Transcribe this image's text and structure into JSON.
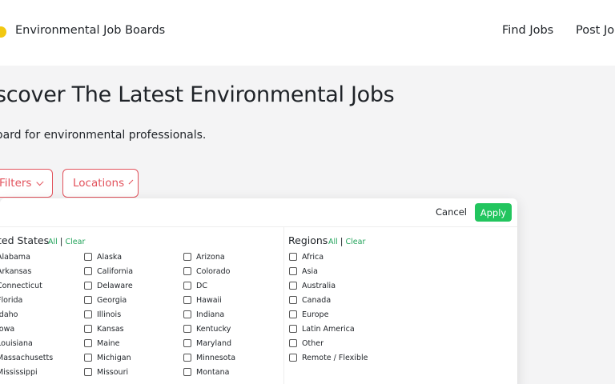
{
  "header": {
    "logo_text": "Environmental Job Boards",
    "nav": [
      "Find Jobs",
      "Post Job"
    ]
  },
  "hero": {
    "title": "scover The Latest Environmental Jobs",
    "subtitle": "oard for environmental professionals."
  },
  "filters": {
    "filters_label": "Filters",
    "locations_label": "Locations"
  },
  "panel": {
    "cancel_label": "Cancel",
    "apply_label": "Apply",
    "us": {
      "title": "ted States",
      "all_label": "All",
      "clear_label": "Clear",
      "col1": [
        "Alabama",
        "Arkansas",
        "Connecticut",
        "Florida",
        "Idaho",
        "Iowa",
        "Louisiana",
        "Massachusetts",
        "Mississippi"
      ],
      "col2": [
        "Alaska",
        "California",
        "Delaware",
        "Georgia",
        "Illinois",
        "Kansas",
        "Maine",
        "Michigan",
        "Missouri"
      ],
      "col3": [
        "Arizona",
        "Colorado",
        "DC",
        "Hawaii",
        "Indiana",
        "Kentucky",
        "Maryland",
        "Minnesota",
        "Montana"
      ]
    },
    "regions": {
      "title": "Regions",
      "all_label": "All",
      "clear_label": "Clear",
      "items": [
        "Africa",
        "Asia",
        "Australia",
        "Canada",
        "Europe",
        "Latin America",
        "Other",
        "Remote / Flexible"
      ]
    }
  },
  "colors": {
    "accent_red": "#e2525c",
    "apply_green": "#22c55e",
    "link_green": "#22a35a",
    "logo_yellow": "#f2c811"
  }
}
